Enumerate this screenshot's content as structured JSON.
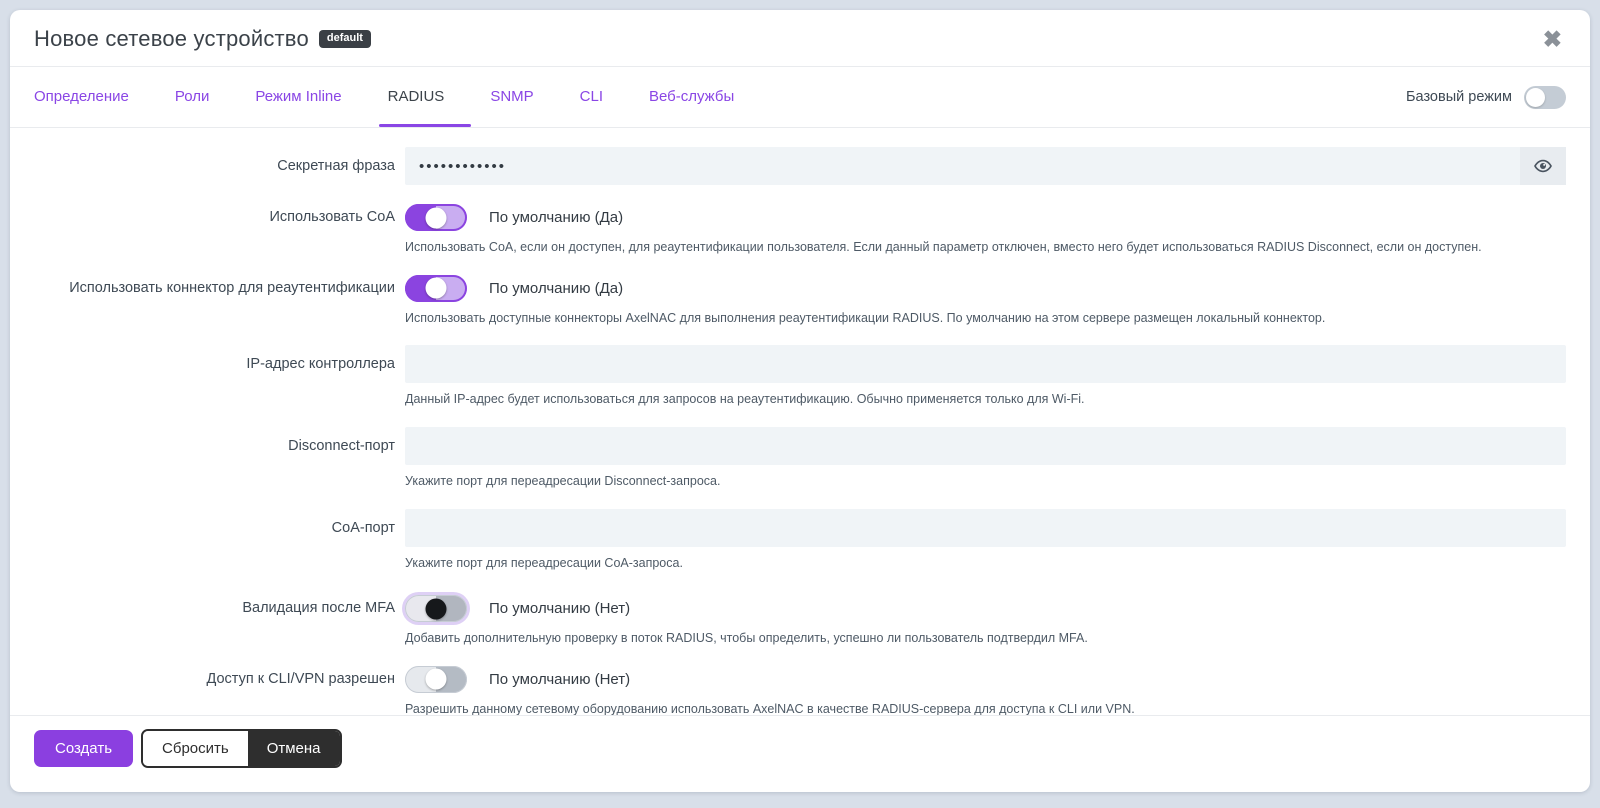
{
  "modal": {
    "title": "Новое сетевое устройство",
    "badge": "default",
    "close_icon": "✖"
  },
  "tabs": {
    "items": [
      {
        "label": "Определение",
        "active": false
      },
      {
        "label": "Роли",
        "active": false
      },
      {
        "label": "Режим Inline",
        "active": false
      },
      {
        "label": "RADIUS",
        "active": true
      },
      {
        "label": "SNMP",
        "active": false
      },
      {
        "label": "CLI",
        "active": false
      },
      {
        "label": "Веб-службы",
        "active": false
      }
    ],
    "basic_mode_label": "Базовый режим",
    "basic_mode_state": "off"
  },
  "form": {
    "fields": [
      {
        "label": "Секретная фраза",
        "type": "password",
        "value": "••••••••••••",
        "eye_icon": "eye"
      },
      {
        "label": "Использовать CoA",
        "type": "toggle",
        "state": "default-on",
        "status": "По умолчанию (Да)",
        "description": "Использовать CoA, если он доступен, для реаутентификации пользователя. Если данный параметр отключен, вместо него будет использоваться RADIUS Disconnect, если он доступен."
      },
      {
        "label": "Использовать коннектор для реаутентификации",
        "type": "toggle",
        "state": "default-on",
        "status": "По умолчанию (Да)",
        "description": "Использовать доступные коннекторы AxelNAC для выполнения реаутентификации RADIUS. По умолчанию на этом сервере размещен локальный коннектор."
      },
      {
        "label": "IP-адрес контроллера",
        "type": "text",
        "value": "",
        "description": "Данный IP-адрес будет использоваться для запросов на реаутентификацию. Обычно применяется только для Wi-Fi."
      },
      {
        "label": "Disconnect-порт",
        "type": "text",
        "value": "",
        "description": "Укажите порт для переадресации Disconnect-запроса."
      },
      {
        "label": "CoA-порт",
        "type": "text",
        "value": "",
        "description": "Укажите порт для переадресации CoA-запроса."
      },
      {
        "label": "Валидация после MFA",
        "type": "toggle",
        "state": "default-off-focused",
        "status": "По умолчанию (Нет)",
        "description": "Добавить дополнительную проверку в поток RADIUS, чтобы определить, успешно ли пользователь подтвердил MFA."
      },
      {
        "label": "Доступ к CLI/VPN разрешен",
        "type": "toggle",
        "state": "default-off",
        "status": "По умолчанию (Нет)",
        "description": "Разрешить данному сетевому оборудованию использовать AxelNAC в качестве RADIUS-сервера для доступа к CLI или VPN."
      }
    ]
  },
  "footer": {
    "create_label": "Создать",
    "reset_label": "Сбросить",
    "cancel_label": "Отмена"
  },
  "colors": {
    "accent_purple": "#8a46e5",
    "toggle_on_track": "#8b44e0",
    "toggle_on_track_light": "#c9adf1",
    "input_background": "#f0f4f7",
    "page_background": "#d8dfe9",
    "badge_background": "#3a3f45",
    "cancel_button": "#2e2e2e",
    "create_button": "#8b3fe0"
  }
}
